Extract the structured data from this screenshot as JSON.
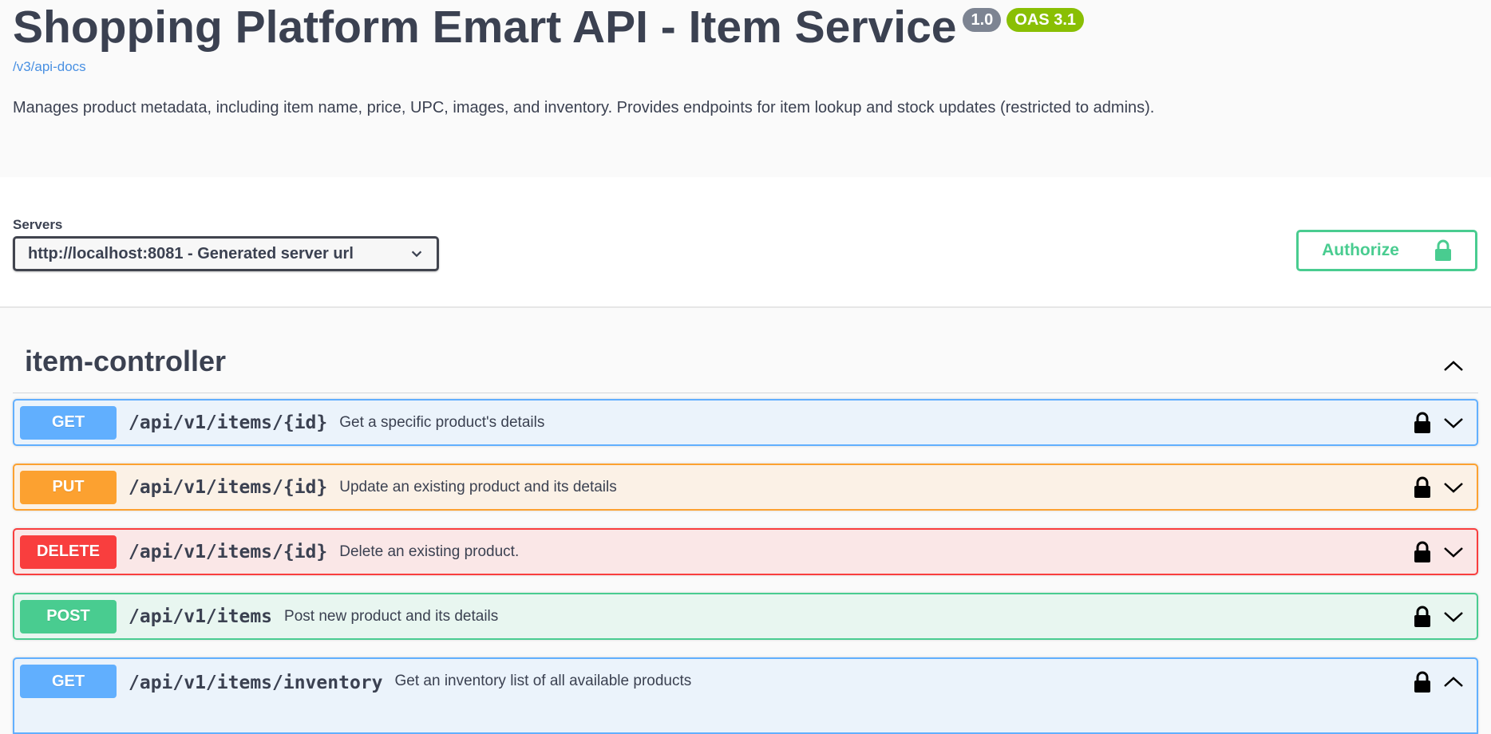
{
  "info": {
    "title": "Shopping Platform Emart API - Item Service",
    "version_badge": "1.0",
    "oas_badge": "OAS 3.1",
    "spec_link": "/v3/api-docs",
    "description": "Manages product metadata, including item name, price, UPC, images, and inventory. Provides endpoints for item lookup and stock updates (restricted to admins)."
  },
  "servers": {
    "label": "Servers",
    "selected": "http://localhost:8081 - Generated server url"
  },
  "authorize": {
    "label": "Authorize"
  },
  "tag": {
    "name": "item-controller",
    "expanded": true
  },
  "operations": [
    {
      "method": "GET",
      "path": "/api/v1/items/{id}",
      "summary": "Get a specific product's details",
      "locked": true,
      "expanded": false
    },
    {
      "method": "PUT",
      "path": "/api/v1/items/{id}",
      "summary": "Update an existing product and its details",
      "locked": true,
      "expanded": false
    },
    {
      "method": "DELETE",
      "path": "/api/v1/items/{id}",
      "summary": "Delete an existing product.",
      "locked": true,
      "expanded": false
    },
    {
      "method": "POST",
      "path": "/api/v1/items",
      "summary": "Post new product and its details",
      "locked": true,
      "expanded": false
    },
    {
      "method": "GET",
      "path": "/api/v1/items/inventory",
      "summary": "Get an inventory list of all available products",
      "locked": true,
      "expanded": true
    }
  ],
  "colors": {
    "get": "#61affe",
    "put": "#fca130",
    "delete": "#f93e3e",
    "post": "#49cc90",
    "authorize": "#49cc90"
  },
  "icons": {
    "server_dropdown": "chevron-down-icon",
    "authorize": "lock-icon",
    "tag_toggle": "chevron-up-icon",
    "op_lock": "lock-icon",
    "op_collapsed": "chevron-down-icon",
    "op_expanded": "chevron-up-icon"
  }
}
